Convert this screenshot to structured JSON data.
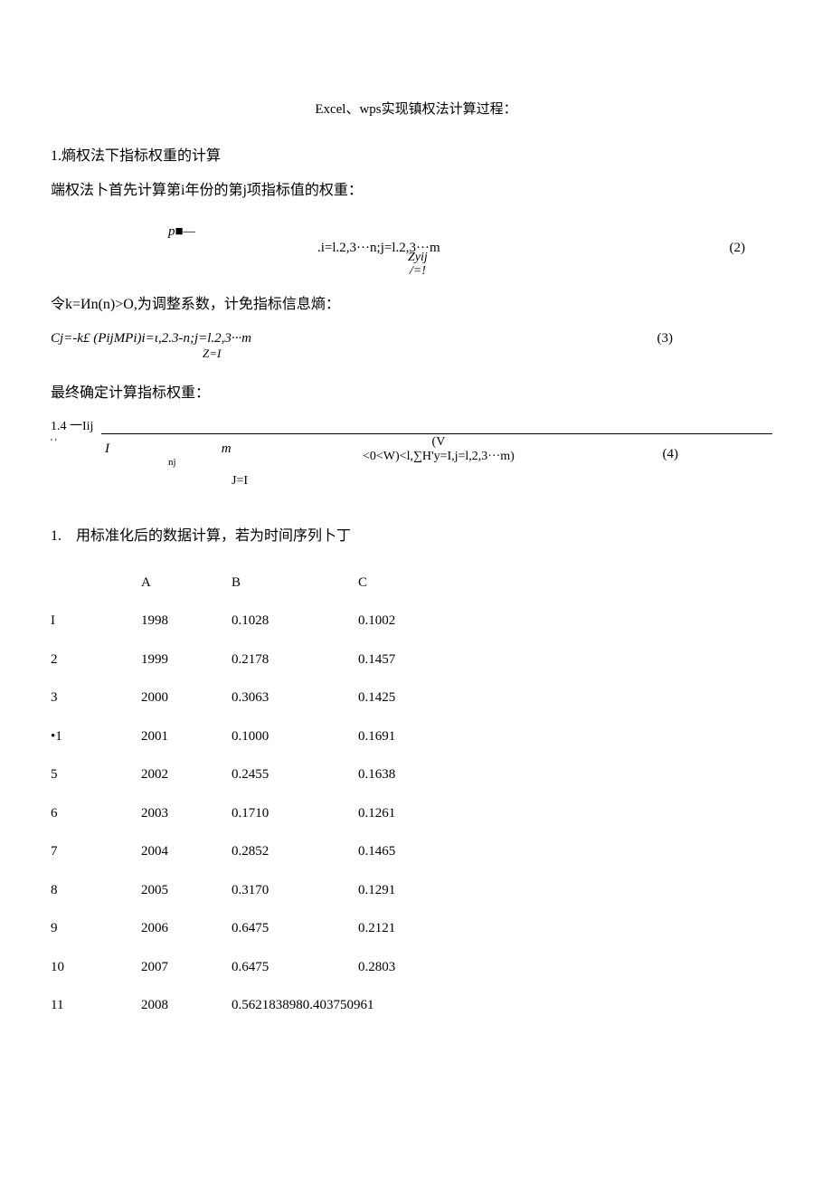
{
  "title": "Excel、wps实现镇权法计算过程：",
  "section1": "1.熵权法下指标权重的计算",
  "section1_text": "端权法卜首先计算第i年份的第j项指标值的权重：",
  "formula1": {
    "lhs": "p■—",
    "cond": ".i=l.2,3···n;j=l.2,3···m",
    "frac_top": "Zyij",
    "frac_bot": "/=!",
    "num": "(2)"
  },
  "section2_text": "令k=Иn(n)>O,为调整系数，计免指标信息熵：",
  "formula2": {
    "eq": "Cj=-k£ (PijMPi)i=ι,2.3-n;j=l.2,3···m",
    "sub": "Z=I",
    "num": "(3)"
  },
  "section3_text": "最终确定计算指标权重：",
  "formula3": {
    "top": "1.4 一Iij",
    "mark": "' '",
    "I": "I",
    "m": "m",
    "nj": "nj",
    "cond_top": "(V",
    "cond_bot": "<0<W)<l,∑H'y=I,j=l,2,3···m)",
    "JI": "J=I",
    "num": "(4)"
  },
  "list_intro": "1.　用标准化后的数据计算，若为时间序列卜丁",
  "table": {
    "header": [
      "",
      "A",
      "B",
      "C"
    ],
    "rows": [
      [
        "I",
        "1998",
        "0.1028",
        "0.1002"
      ],
      [
        "2",
        "1999",
        "0.2178",
        "0.1457"
      ],
      [
        "3",
        "2000",
        "0.3063",
        "0.1425"
      ],
      [
        "•1",
        "2001",
        "0.1000",
        "0.1691"
      ],
      [
        "5",
        "2002",
        "0.2455",
        "0.1638"
      ],
      [
        "6",
        "2003",
        "0.1710",
        "0.1261"
      ],
      [
        "7",
        "2004",
        "0.2852",
        "0.1465"
      ],
      [
        "8",
        "2005",
        "0.3170",
        "0.1291"
      ],
      [
        "9",
        "2006",
        "0.6475",
        "0.2121"
      ],
      [
        "10",
        "2007",
        "0.6475",
        "0.2803"
      ],
      [
        "11",
        "2008",
        "0.5621838980.403750961",
        ""
      ]
    ]
  }
}
